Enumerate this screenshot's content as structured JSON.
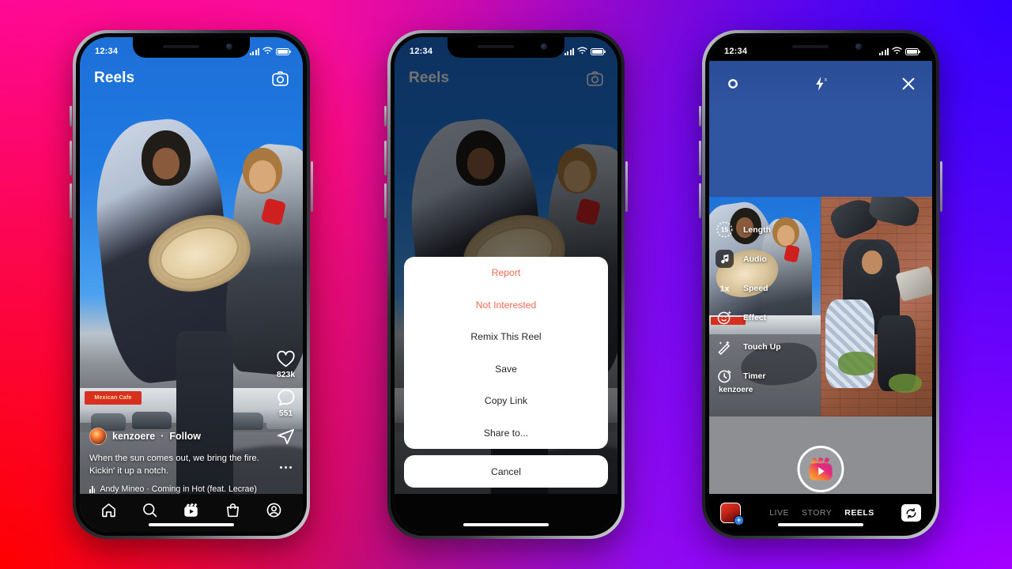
{
  "background": {
    "colors": [
      "#ff0aa8",
      "#3300ff",
      "#ff0000",
      "#c000ff"
    ]
  },
  "status_bar": {
    "time": "12:34",
    "signal_icon": "cellular-signal-icon",
    "wifi_icon": "wifi-icon",
    "battery_icon": "battery-icon"
  },
  "phone1": {
    "header": {
      "title": "Reels",
      "camera_icon": "camera-icon"
    },
    "actions": {
      "like": {
        "icon": "heart-icon",
        "count": "823k"
      },
      "comment": {
        "icon": "comment-icon",
        "count": "551"
      },
      "share": {
        "icon": "send-arrow-icon"
      },
      "more": {
        "icon": "more-dots-icon"
      }
    },
    "post": {
      "username": "kenzoere",
      "separator": "·",
      "follow_label": "Follow",
      "caption_line1": "When the sun comes out, we bring the fire.",
      "caption_line2": "Kickin' it up a notch.",
      "audio": "Andy Mineo · Coming in Hot (feat. Lecrae)",
      "audio_icon": "audio-waveform-icon"
    },
    "storefront_sign": "Mexican Cafe",
    "tabbar": [
      {
        "name": "home-icon",
        "label": "Home"
      },
      {
        "name": "search-icon",
        "label": "Search"
      },
      {
        "name": "reels-icon",
        "label": "Reels"
      },
      {
        "name": "shop-icon",
        "label": "Shop"
      },
      {
        "name": "profile-icon",
        "label": "Profile"
      }
    ]
  },
  "phone2": {
    "header": {
      "title": "Reels",
      "camera_icon": "camera-icon"
    },
    "action_sheet": {
      "items": [
        {
          "label": "Report",
          "style": "danger"
        },
        {
          "label": "Not Interested",
          "style": "danger"
        },
        {
          "label": "Remix This Reel",
          "style": "default"
        },
        {
          "label": "Save",
          "style": "default"
        },
        {
          "label": "Copy Link",
          "style": "default"
        },
        {
          "label": "Share to...",
          "style": "default"
        }
      ],
      "cancel_label": "Cancel",
      "danger_color": "#ed6b52",
      "default_color": "#262626"
    }
  },
  "phone3": {
    "top_bar": {
      "settings_icon": "gear-icon",
      "flash_icon": "flash-off-icon",
      "close_icon": "close-x-icon"
    },
    "tools": [
      {
        "label": "Length",
        "icon": "length-dial-icon",
        "value": "15"
      },
      {
        "label": "Audio",
        "icon": "audio-note-icon"
      },
      {
        "label": "Speed",
        "icon": "speed-icon",
        "value": "1x"
      },
      {
        "label": "Effect",
        "icon": "effect-smiley-icon"
      },
      {
        "label": "Touch Up",
        "icon": "touch-up-wand-icon"
      },
      {
        "label": "Timer",
        "icon": "timer-clock-icon"
      }
    ],
    "username_overlay": "kenzoere",
    "record_button": {
      "icon": "reels-clapper-icon",
      "label": "Record"
    },
    "gallery_button": {
      "icon": "gallery-thumbnail-icon",
      "badge": "+"
    },
    "modes": [
      {
        "label": "LIVE",
        "active": false
      },
      {
        "label": "STORY",
        "active": false
      },
      {
        "label": "REELS",
        "active": true
      }
    ],
    "flip_camera_icon": "flip-camera-icon"
  }
}
